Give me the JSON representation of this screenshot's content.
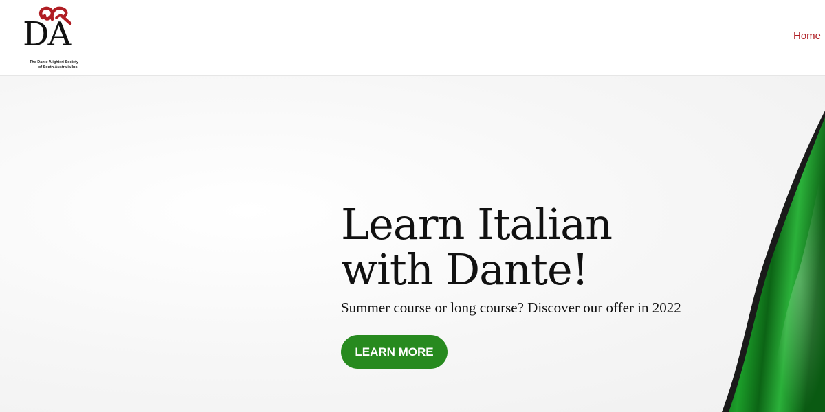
{
  "header": {
    "logo": {
      "monogram": "DA",
      "caption_line1": "The Dante Alighieri Society",
      "caption_line2": "of South Australia Inc."
    },
    "nav": {
      "home_label": "Home"
    }
  },
  "hero": {
    "title": "Learn Italian with Dante!",
    "subtitle": "Summer course or long course? Discover our offer in 2022",
    "cta_label": "LEARN MORE"
  },
  "colors": {
    "brand_red": "#b01e24",
    "cta_green": "#278a1f",
    "flag_green": "#0f7a1a"
  },
  "icons": {
    "logo_mark": "ornamental-ribbon-icon"
  }
}
